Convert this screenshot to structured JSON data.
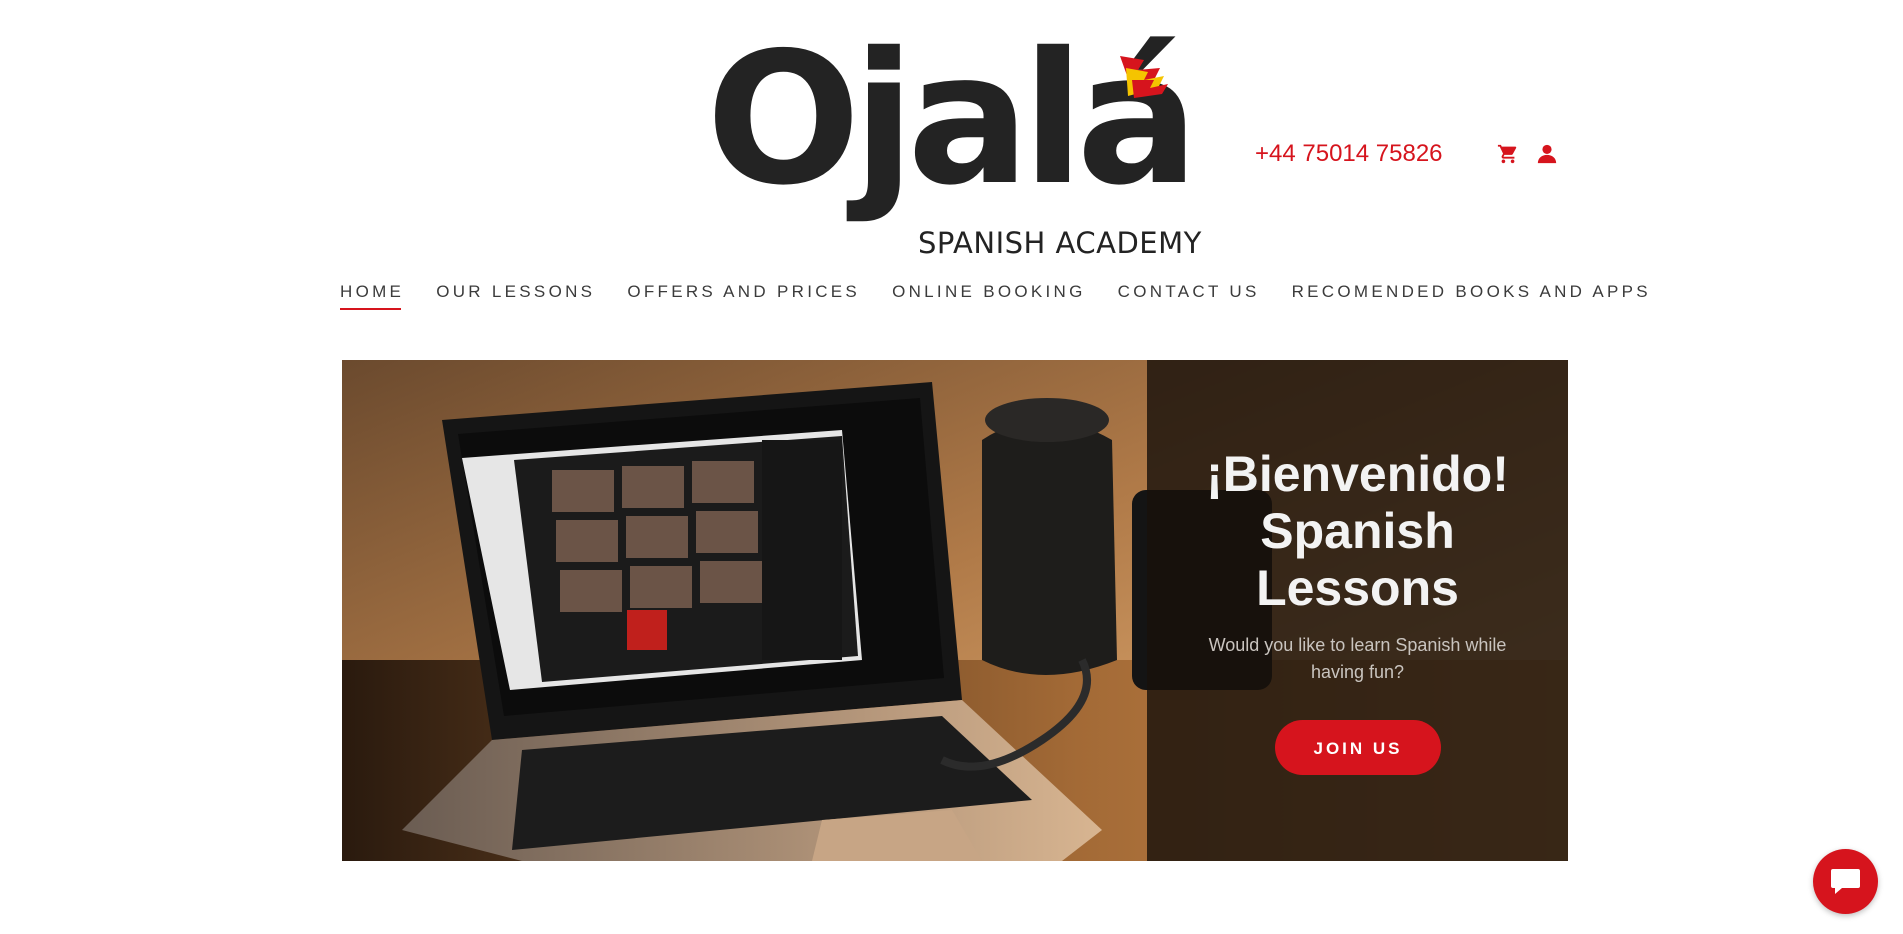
{
  "brand": {
    "logo_word": "Ojalá",
    "logo_subtitle": "SPANISH ACADEMY",
    "flag_icon": "spain-flag-wing-icon",
    "colors": {
      "accent": "#d6141d",
      "flag_yellow": "#f5c400",
      "text_dark": "#232323"
    }
  },
  "header": {
    "phone": "+44 75014 75826",
    "cart_icon": "cart-icon",
    "account_icon": "user-icon"
  },
  "nav": {
    "items": [
      {
        "label": "HOME",
        "active": true
      },
      {
        "label": "OUR LESSONS"
      },
      {
        "label": "OFFERS AND PRICES"
      },
      {
        "label": "ONLINE BOOKING"
      },
      {
        "label": "CONTACT US"
      },
      {
        "label": "RECOMENDED BOOKS AND APPS"
      }
    ]
  },
  "hero": {
    "title_lines": [
      "¡Bienvenido!",
      "Spanish",
      "Lessons"
    ],
    "subtitle": "Would you like to learn Spanish while having fun?",
    "cta_label": "JOIN US",
    "image_alt": "laptop-video-call-photo"
  },
  "chat": {
    "icon": "chat-bubble-icon"
  }
}
